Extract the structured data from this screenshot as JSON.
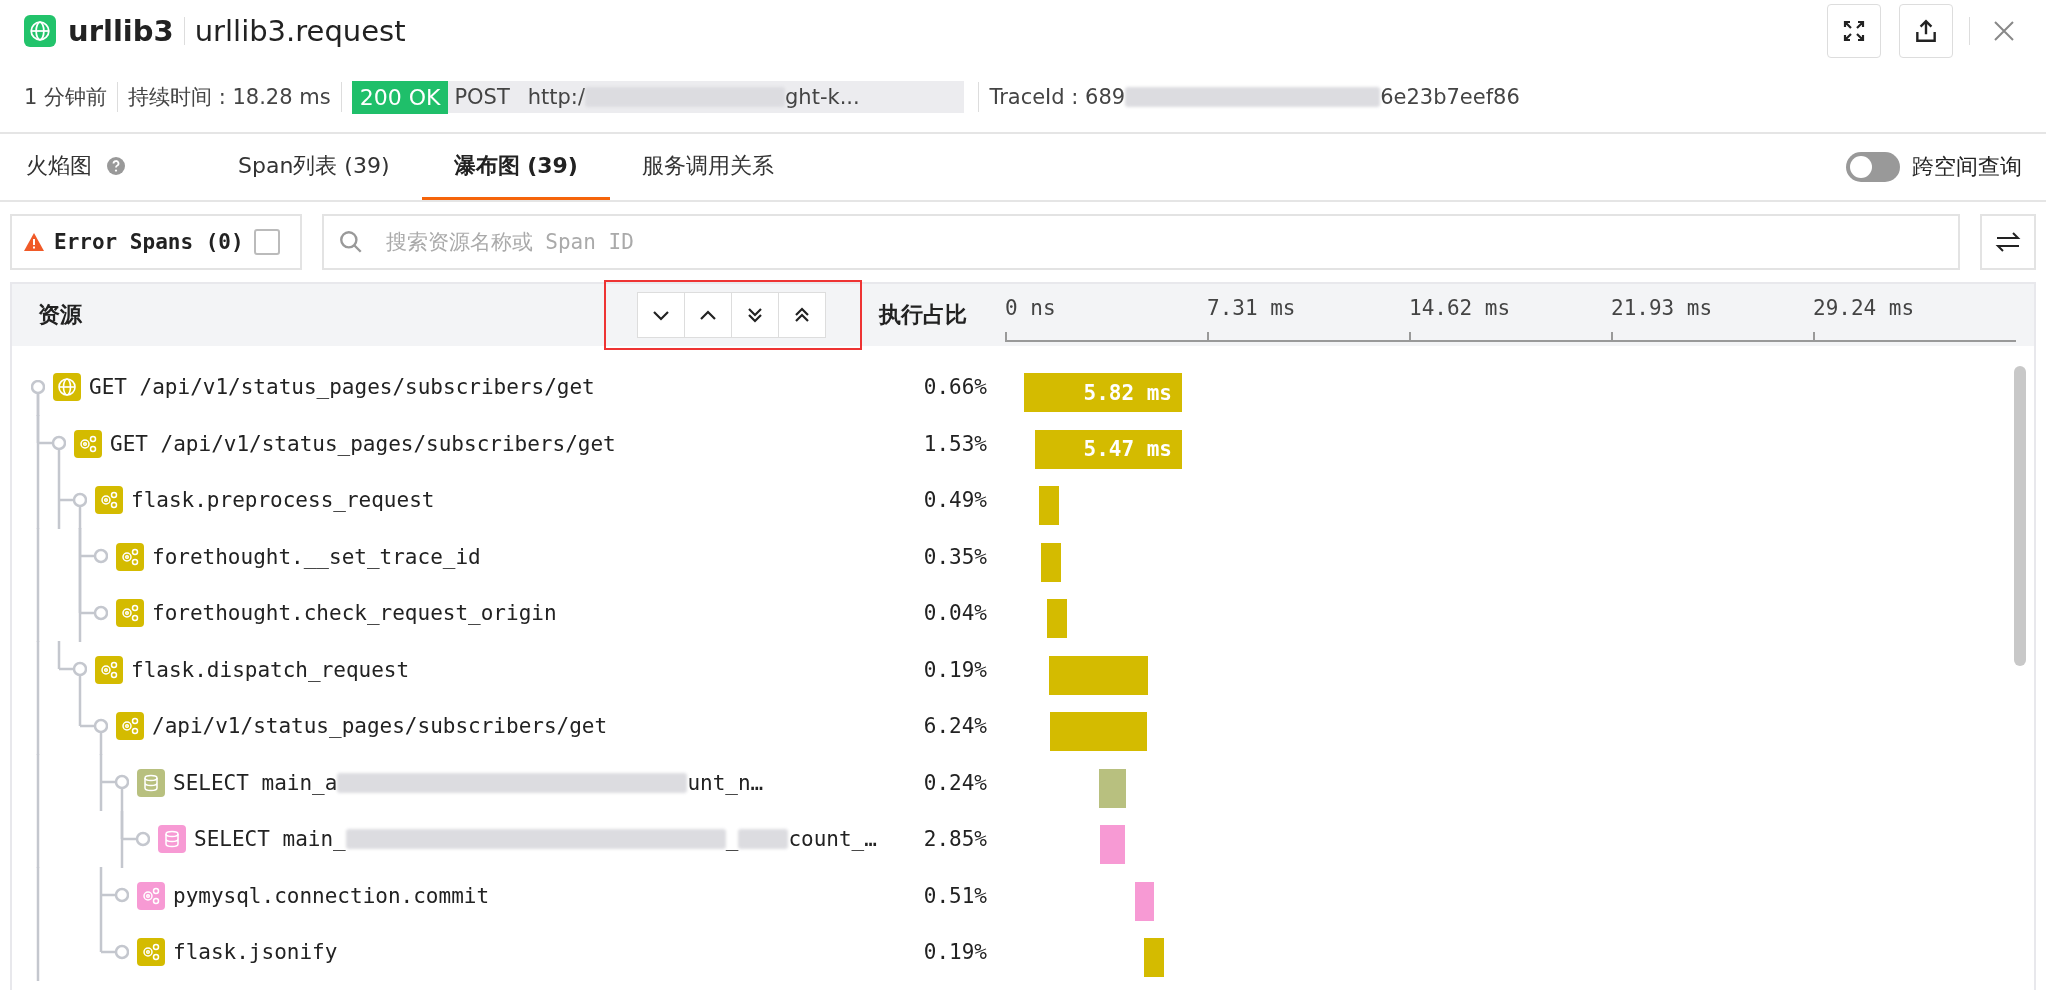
{
  "header": {
    "service": "urllib3",
    "operation": "urllib3.request"
  },
  "meta": {
    "time_ago": "1 分钟前",
    "duration": "持续时间 : 18.28 ms",
    "status": "200 OK",
    "method": "POST",
    "url_parts": [
      "http:/",
      "ght-k..."
    ],
    "trace_parts": [
      "TraceId : 689",
      "6e23b7eef86"
    ]
  },
  "tabs": [
    {
      "label": "火焰图",
      "kind": "help",
      "selected": false
    },
    {
      "label": "Span列表 (39)",
      "kind": "plain",
      "selected": false
    },
    {
      "label": "瀑布图 (39)",
      "kind": "plain",
      "selected": true
    },
    {
      "label": "服务调用关系",
      "kind": "plain",
      "selected": false
    }
  ],
  "cross_space": {
    "label": "跨空间查询",
    "on": false
  },
  "error_filter": {
    "label": "Error Spans (0)",
    "checked": false
  },
  "search": {
    "placeholder": "搜索资源名称或 Span ID"
  },
  "table": {
    "columns": [
      "资源",
      "执行占比"
    ],
    "axis_ticks": [
      "0 ns",
      "7.31 ms",
      "14.62 ms",
      "21.93 ms",
      "29.24 ms"
    ],
    "spans": [
      {
        "kind": "http",
        "color": "#d4bb00",
        "name_parts": [
          "GET /api/v1/status_pages/subscribers/get"
        ],
        "percent": "0.66%",
        "label": "5.82 ms",
        "children": [
          {
            "kind": "service",
            "color": "#d4bb00",
            "name_parts": [
              "GET /api/v1/status_pages/subscribers/get"
            ],
            "percent": "1.53%",
            "label": "5.47 ms",
            "children": [
              {
                "kind": "service",
                "color": "#d4bb00",
                "name_parts": [
                  "flask.preprocess_request"
                ],
                "percent": "0.49%",
                "children": [
                  {
                    "kind": "service",
                    "color": "#d4bb00",
                    "name_parts": [
                      "forethought.__set_trace_id"
                    ],
                    "percent": "0.35%"
                  },
                  {
                    "kind": "service",
                    "color": "#d4bb00",
                    "name_parts": [
                      "forethought.check_request_origin"
                    ],
                    "percent": "0.04%"
                  }
                ]
              },
              {
                "kind": "service",
                "color": "#d4bb00",
                "name_parts": [
                  "flask.dispatch_request"
                ],
                "percent": "0.19%",
                "children": [
                  {
                    "kind": "service",
                    "color": "#d4bb00",
                    "name_parts": [
                      "/api/v1/status_pages/subscribers/get"
                    ],
                    "percent": "6.24%",
                    "children": [
                      {
                        "kind": "database",
                        "color": "#b8c07f",
                        "name_parts": [
                          "SELECT main_a",
                          "unt_n…"
                        ],
                        "percent": "0.24%",
                        "children": [
                          {
                            "kind": "database",
                            "color": "#f79ad4",
                            "name_parts": [
                              "SELECT main_",
                              "_",
                              "count_…"
                            ],
                            "percent": "2.85%"
                          }
                        ]
                      },
                      {
                        "kind": "service",
                        "color": "#f79ad4",
                        "name_parts": [
                          "pymysql.connection.commit"
                        ],
                        "percent": "0.51%"
                      },
                      {
                        "kind": "service",
                        "color": "#d4bb00",
                        "name_parts": [
                          "flask.jsonify"
                        ],
                        "percent": "0.19%"
                      }
                    ]
                  }
                ]
              }
            ]
          }
        ]
      }
    ]
  }
}
